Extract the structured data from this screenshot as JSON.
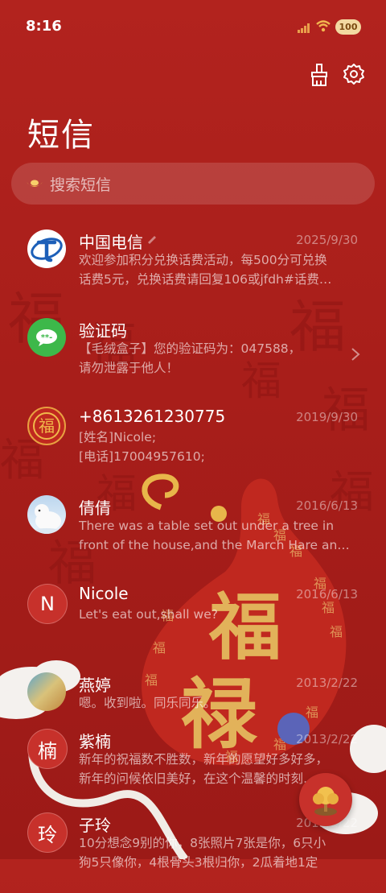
{
  "status": {
    "time": "8:16",
    "battery": "100"
  },
  "header": {
    "title": "短信"
  },
  "search": {
    "placeholder": "搜索短信"
  },
  "conversations": [
    {
      "name": "中国电信",
      "date": "2025/9/30",
      "line1": "欢迎参加积分兑换话费活动，每500分可兑换",
      "line2": "话费5元，兑换话费请回复106或jfdh#话费…",
      "avatar": "china-telecom-logo"
    },
    {
      "name": "验证码",
      "date": "",
      "line1": "【毛绒盒子】您的验证码为：047588，",
      "line2": "请勿泄露于他人！",
      "avatar": "message-bubble-icon"
    },
    {
      "name": "+8613261230775",
      "date": "2019/9/30",
      "line1": "[姓名]Nicole;",
      "line2": "[电话]17004957610;",
      "avatar": "fu-seal-icon"
    },
    {
      "name": "倩倩",
      "date": "2016/6/13",
      "line1": "There was a table set out under a tree in",
      "line2": "front of the house,and the March Hare an…",
      "avatar": "polar-bear-photo"
    },
    {
      "name": "Nicole",
      "date": "2016/6/13",
      "line1": "Let's eat out,shall we?",
      "line2": "",
      "avatar_letter": "N"
    },
    {
      "name": "燕婷",
      "date": "2013/2/22",
      "line1": "嗯。收到啦。同乐同乐。",
      "line2": "",
      "avatar": "landscape-photo"
    },
    {
      "name": "紫楠",
      "date": "2013/2/22",
      "line1": "新年的祝福数不胜数，新年的愿望好多好多，",
      "line2": "新年的问候依旧美好，在这个温馨的时刻…",
      "avatar_letter": "楠"
    },
    {
      "name": "子玲",
      "date": "2013/2/22",
      "line1": "10分想念9别的你，8张照片7张是你，6只小",
      "line2": "狗5只像你，4根骨头3根归你，2瓜着地1定",
      "avatar_letter": "玲"
    }
  ],
  "colors": {
    "background": "#a81e1a",
    "accent": "#c7312b",
    "gold": "#e8b64a"
  }
}
